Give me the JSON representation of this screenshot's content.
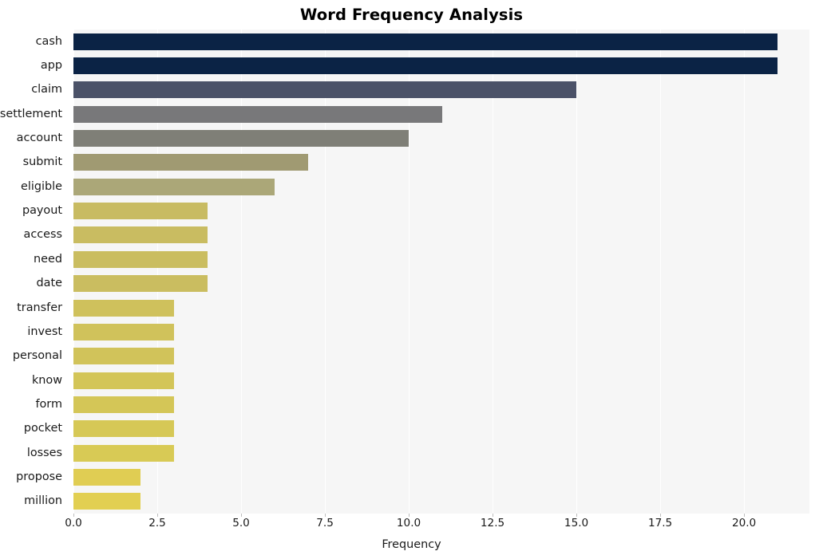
{
  "chart_data": {
    "type": "bar",
    "orientation": "horizontal",
    "title": "Word Frequency Analysis",
    "xlabel": "Frequency",
    "ylabel": "",
    "xlim": [
      0,
      21.95
    ],
    "xticks": [
      0.0,
      2.5,
      5.0,
      7.5,
      10.0,
      12.5,
      15.0,
      17.5,
      20.0
    ],
    "xtick_labels": [
      "0.0",
      "2.5",
      "5.0",
      "7.5",
      "10.0",
      "12.5",
      "15.0",
      "17.5",
      "20.0"
    ],
    "grid": true,
    "legend": null,
    "colormap": "cividis",
    "categories": [
      "cash",
      "app",
      "claim",
      "settlement",
      "account",
      "submit",
      "eligible",
      "payout",
      "access",
      "need",
      "date",
      "transfer",
      "invest",
      "personal",
      "know",
      "form",
      "pocket",
      "losses",
      "propose",
      "million"
    ],
    "values": [
      21,
      21,
      15,
      11,
      10,
      7,
      6,
      4,
      4,
      4,
      4,
      3,
      3,
      3,
      3,
      3,
      3,
      3,
      2,
      2
    ],
    "bar_colors": [
      "#0b2345",
      "#0b2345",
      "#4b5268",
      "#78787a",
      "#7f7f77",
      "#a09a72",
      "#aba778",
      "#c8bb62",
      "#c9bc61",
      "#cabd60",
      "#cabd60",
      "#cfc15c",
      "#d0c25b",
      "#d1c35a",
      "#d3c558",
      "#d4c657",
      "#d6c856",
      "#d8ca55",
      "#e0cd53",
      "#e2cf52"
    ],
    "bars": [
      {
        "label": "cash",
        "value": 21,
        "color": "#0b2345"
      },
      {
        "label": "app",
        "value": 21,
        "color": "#0b2345"
      },
      {
        "label": "claim",
        "value": 15,
        "color": "#4b5268"
      },
      {
        "label": "settlement",
        "value": 11,
        "color": "#78787a"
      },
      {
        "label": "account",
        "value": 10,
        "color": "#7f7f77"
      },
      {
        "label": "submit",
        "value": 7,
        "color": "#a09a72"
      },
      {
        "label": "eligible",
        "value": 6,
        "color": "#aba778"
      },
      {
        "label": "payout",
        "value": 4,
        "color": "#c8bb62"
      },
      {
        "label": "access",
        "value": 4,
        "color": "#c9bc61"
      },
      {
        "label": "need",
        "value": 4,
        "color": "#cabd60"
      },
      {
        "label": "date",
        "value": 4,
        "color": "#cabd60"
      },
      {
        "label": "transfer",
        "value": 3,
        "color": "#cfc15c"
      },
      {
        "label": "invest",
        "value": 3,
        "color": "#d0c25b"
      },
      {
        "label": "personal",
        "value": 3,
        "color": "#d1c35a"
      },
      {
        "label": "know",
        "value": 3,
        "color": "#d3c558"
      },
      {
        "label": "form",
        "value": 3,
        "color": "#d4c657"
      },
      {
        "label": "pocket",
        "value": 3,
        "color": "#d6c856"
      },
      {
        "label": "losses",
        "value": 3,
        "color": "#d8ca55"
      },
      {
        "label": "propose",
        "value": 2,
        "color": "#e0cd53"
      },
      {
        "label": "million",
        "value": 2,
        "color": "#e2cf52"
      }
    ],
    "style": {
      "plot_background": "#f6f6f6",
      "figure_background": "#ffffff",
      "gridline_color": "#ffffff",
      "text_color": "#1a1a1a",
      "title_color": "#000000"
    }
  }
}
